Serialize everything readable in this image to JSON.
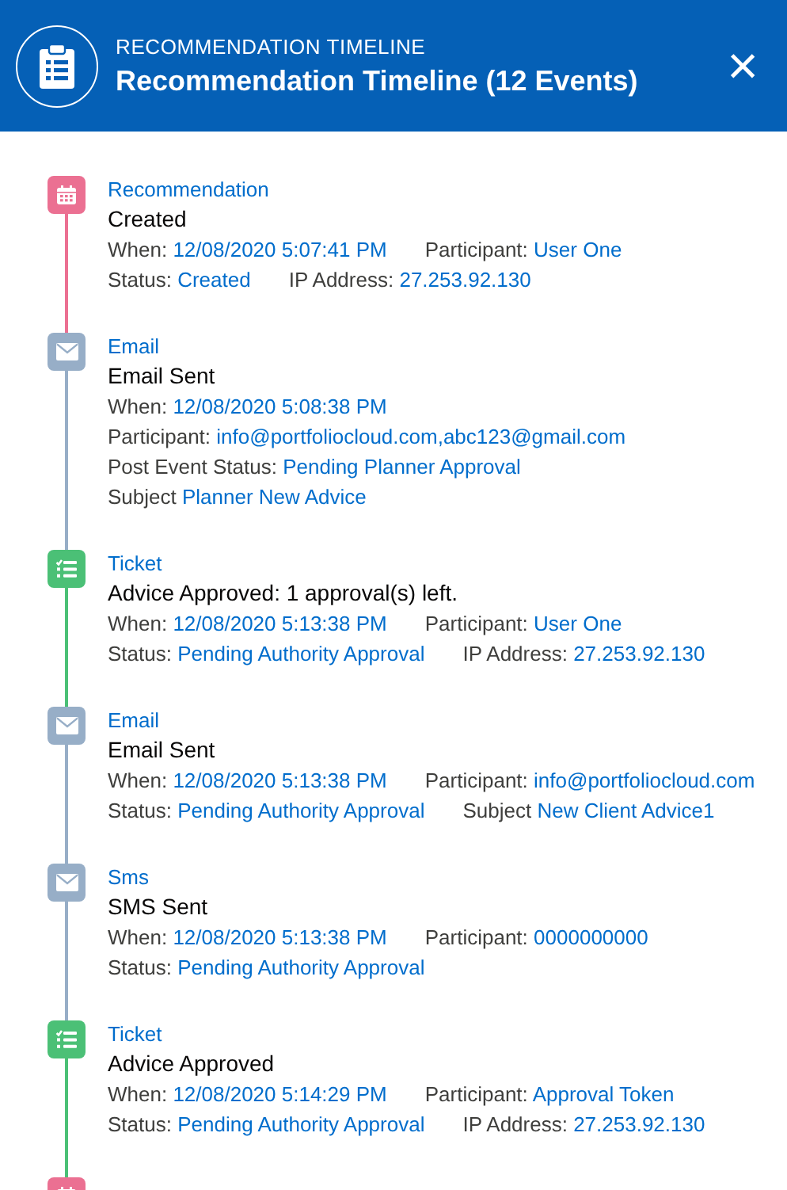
{
  "header": {
    "subtitle": "RECOMMENDATION TIMELINE",
    "title": "Recommendation Timeline (12 Events)",
    "close": "×"
  },
  "events": [
    {
      "kind": "calendar",
      "color": "#eb7092",
      "title": "Recommendation",
      "description": "Created",
      "rows": [
        [
          {
            "label": "When:",
            "value": "12/08/2020 5:07:41 PM"
          },
          {
            "label": "Participant:",
            "value": "User One"
          }
        ],
        [
          {
            "label": "Status:",
            "value": "Created"
          },
          {
            "label": "IP Address:",
            "value": "27.253.92.130"
          }
        ]
      ]
    },
    {
      "kind": "email",
      "color": "#97aec7",
      "title": "Email",
      "description": "Email Sent",
      "rows": [
        [
          {
            "label": "When:",
            "value": "12/08/2020 5:08:38 PM"
          }
        ],
        [
          {
            "label": "Participant:",
            "value": "info@portfoliocloud.com,abc123@gmail.com"
          }
        ],
        [
          {
            "label": "Post Event Status:",
            "value": "Pending Planner Approval"
          }
        ],
        [
          {
            "label": "Subject",
            "value": "Planner New Advice"
          }
        ]
      ]
    },
    {
      "kind": "ticket",
      "color": "#4bc076",
      "title": "Ticket",
      "description": "Advice Approved: 1 approval(s) left.",
      "rows": [
        [
          {
            "label": "When:",
            "value": "12/08/2020 5:13:38 PM"
          },
          {
            "label": "Participant:",
            "value": "User One"
          }
        ],
        [
          {
            "label": "Status:",
            "value": "Pending Authority Approval"
          },
          {
            "label": "IP Address:",
            "value": "27.253.92.130"
          }
        ]
      ]
    },
    {
      "kind": "email",
      "color": "#97aec7",
      "title": "Email",
      "description": "Email Sent",
      "rows": [
        [
          {
            "label": "When:",
            "value": "12/08/2020 5:13:38 PM"
          },
          {
            "label": "Participant:",
            "value": "info@portfoliocloud.com"
          }
        ],
        [
          {
            "label": "Status:",
            "value": "Pending Authority Approval"
          },
          {
            "label": "Subject",
            "value": "New Client Advice1"
          }
        ]
      ]
    },
    {
      "kind": "email",
      "color": "#97aec7",
      "title": "Sms",
      "description": "SMS Sent",
      "rows": [
        [
          {
            "label": "When:",
            "value": "12/08/2020 5:13:38 PM"
          },
          {
            "label": "Participant:",
            "value": "0000000000"
          }
        ],
        [
          {
            "label": "Status:",
            "value": "Pending Authority Approval"
          }
        ]
      ]
    },
    {
      "kind": "ticket",
      "color": "#4bc076",
      "title": "Ticket",
      "description": "Advice Approved",
      "rows": [
        [
          {
            "label": "When:",
            "value": "12/08/2020 5:14:29 PM"
          },
          {
            "label": "Participant:",
            "value": "Approval Token"
          }
        ],
        [
          {
            "label": "Status:",
            "value": "Pending Authority Approval"
          },
          {
            "label": "IP Address:",
            "value": "27.253.92.130"
          }
        ]
      ]
    },
    {
      "kind": "calendar",
      "color": "#eb7092"
    }
  ]
}
